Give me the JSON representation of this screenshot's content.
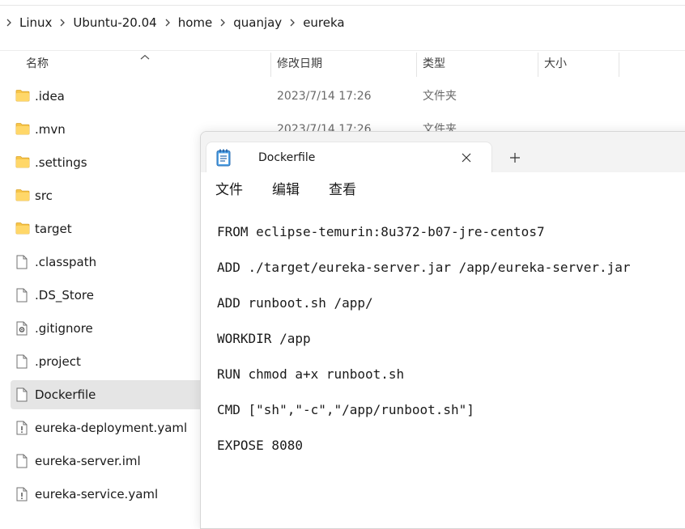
{
  "breadcrumb": [
    "Linux",
    "Ubuntu-20.04",
    "home",
    "quanjay",
    "eureka"
  ],
  "columns": {
    "name": "名称",
    "modified": "修改日期",
    "type": "类型",
    "size": "大小"
  },
  "files": [
    {
      "name": ".idea",
      "icon": "folder-icon",
      "date": "2023/7/14 17:26",
      "type": "文件夹"
    },
    {
      "name": ".mvn",
      "icon": "folder-icon",
      "date": "2023/7/14 17:26",
      "type": "文件夹"
    },
    {
      "name": ".settings",
      "icon": "folder-icon"
    },
    {
      "name": "src",
      "icon": "folder-icon"
    },
    {
      "name": "target",
      "icon": "folder-icon"
    },
    {
      "name": ".classpath",
      "icon": "file-icon"
    },
    {
      "name": ".DS_Store",
      "icon": "file-icon"
    },
    {
      "name": ".gitignore",
      "icon": "config-file-icon"
    },
    {
      "name": ".project",
      "icon": "file-icon"
    },
    {
      "name": "Dockerfile",
      "icon": "file-icon",
      "selected": true
    },
    {
      "name": "eureka-deployment.yaml",
      "icon": "yaml-file-icon"
    },
    {
      "name": "eureka-server.iml",
      "icon": "file-icon"
    },
    {
      "name": "eureka-service.yaml",
      "icon": "yaml-file-icon"
    }
  ],
  "notepad": {
    "tab_title": "Dockerfile",
    "tab_icon": "notepad-icon",
    "menu": [
      "文件",
      "编辑",
      "查看"
    ],
    "content_lines": [
      "FROM eclipse-temurin:8u372-b07-jre-centos7",
      "ADD ./target/eureka-server.jar /app/eureka-server.jar",
      "ADD runboot.sh /app/",
      "WORKDIR /app",
      "RUN chmod a+x runboot.sh",
      "CMD [\"sh\",\"-c\",\"/app/runboot.sh\"]",
      "EXPOSE 8080"
    ]
  },
  "colors": {
    "folder": "#f7c548",
    "selected_row": "#e5e5e5",
    "notepad_icon": "#1e88e5"
  }
}
